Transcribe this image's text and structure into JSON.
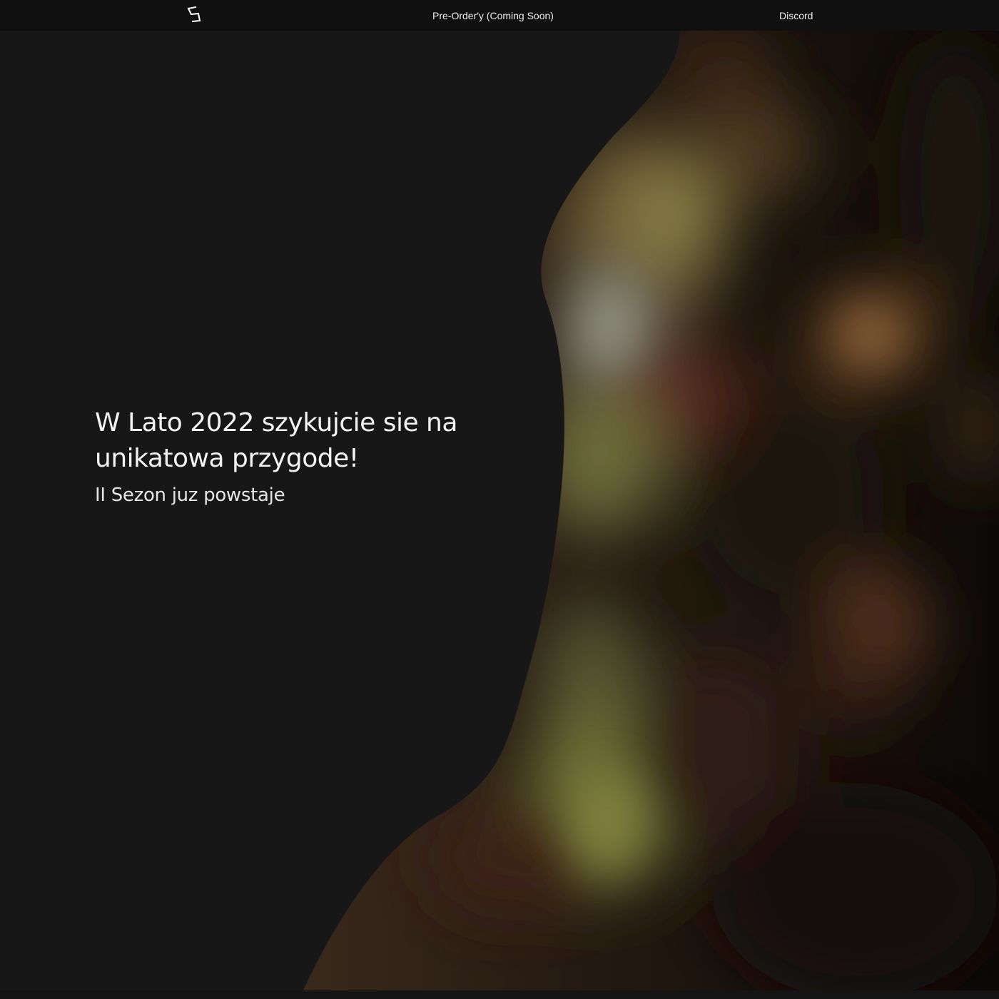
{
  "header": {
    "logo_icon": "brand-s-logo-icon",
    "nav": [
      {
        "label": "Pre-Order'y (Coming Soon)"
      },
      {
        "label": "Discord"
      }
    ]
  },
  "hero": {
    "title": "W Lato 2022 szykujcie sie na unikatowa przygode!",
    "subtitle": "II Sezon juz powstaje"
  },
  "colors": {
    "background": "#171717",
    "topbar": "#101010",
    "text": "#f3f3f3"
  }
}
